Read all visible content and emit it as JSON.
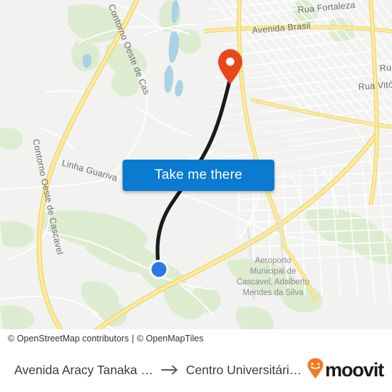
{
  "map": {
    "background_color": "#f2f2f0",
    "road_major_color": "#f7dd7c",
    "road_minor_color": "#ffffff",
    "green_color": "#dceccd",
    "water_color": "#aad3e5",
    "route_color": "#1b1b1b",
    "labels": [
      {
        "id": "contorno-oeste-top",
        "text": "Contorno Oeste de Cas"
      },
      {
        "id": "contorno-oeste-bottom",
        "text": "Contorno Oeste de Cascavel"
      },
      {
        "id": "linha-guariva",
        "text": "Linha Guariva"
      },
      {
        "id": "rua-fortaleza",
        "text": "Rua Fortaleza"
      },
      {
        "id": "avenida-brasil",
        "text": "Avenida Brasil"
      },
      {
        "id": "rua-right-top",
        "text": "Rua"
      },
      {
        "id": "rua-vitoria",
        "text": "Rua Vitó"
      }
    ],
    "poi": {
      "airport": {
        "line1": "Aeroporto",
        "line2": "Municipal de",
        "line3": "Cascavel, Adalberto",
        "line4": "Mendes da Silva"
      }
    },
    "markers": {
      "destination": {
        "name": "destination-pin",
        "color": "#e8471c"
      },
      "origin": {
        "name": "origin-dot",
        "color": "#2b7ae4"
      }
    }
  },
  "cta": {
    "label": "Take me there",
    "background_color": "#0b7ad1",
    "text_color": "#ffffff"
  },
  "attribution": {
    "osm": "© OpenStreetMap contributors",
    "separator": "|",
    "tiles": "© OpenMapTiles"
  },
  "footer": {
    "origin": "Avenida Aracy Tanaka Bia...",
    "arrow": "→",
    "destination": "Centro Universitário D...",
    "logo_text": "moovit",
    "logo_color": "#f47b20"
  }
}
